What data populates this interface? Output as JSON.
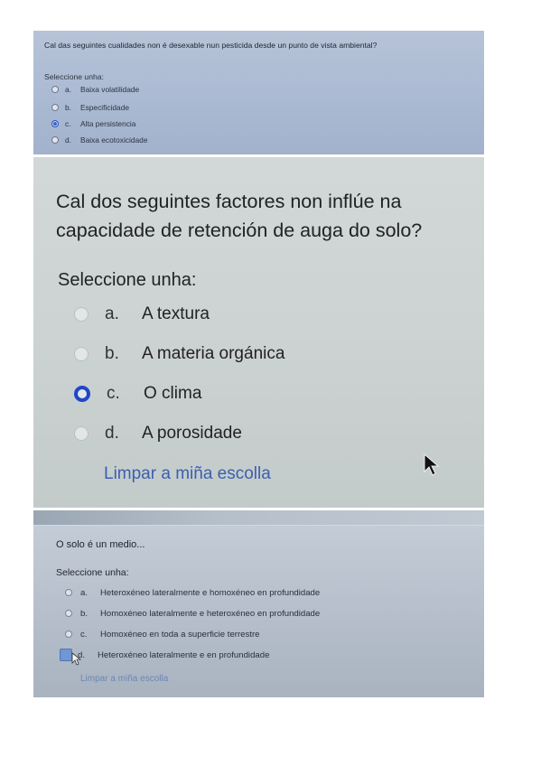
{
  "panel1": {
    "question": "Cal das seguintes cualidades non é desexable nun pesticida desde un punto de vista ambiental?",
    "prompt": "Seleccione unha:",
    "options": [
      {
        "letter": "a.",
        "text": "Baixa volatilidade",
        "selected": false
      },
      {
        "letter": "b.",
        "text": "Especificidade",
        "selected": false
      },
      {
        "letter": "c.",
        "text": "Alta persistencia",
        "selected": true
      },
      {
        "letter": "d.",
        "text": "Baixa ecotoxicidade",
        "selected": false
      }
    ]
  },
  "panel2": {
    "question": "Cal dos seguintes factores non inflúe na capacidade de retención de auga do solo?",
    "prompt": "Seleccione unha:",
    "options": [
      {
        "letter": "a.",
        "text": "A textura",
        "selected": false
      },
      {
        "letter": "b.",
        "text": "A materia orgánica",
        "selected": false
      },
      {
        "letter": "c.",
        "text": "O clima",
        "selected": true
      },
      {
        "letter": "d.",
        "text": "A porosidade",
        "selected": false
      }
    ],
    "clear_label": "Limpar a miña escolla"
  },
  "panel3": {
    "question": "O solo é un medio...",
    "prompt": "Seleccione unha:",
    "options": [
      {
        "letter": "a.",
        "text": "Heteroxéneo lateralmente e homoxéneo en profundidade",
        "selected": false
      },
      {
        "letter": "b.",
        "text": "Homoxéneo lateralmente e heteroxéneo en profundidade",
        "selected": false
      },
      {
        "letter": "c.",
        "text": "Homoxéneo en toda a superficie terrestre",
        "selected": false
      },
      {
        "letter": "d.",
        "text": "Heteroxéneo lateralmente e en profundidade",
        "selected": true
      }
    ],
    "clear_label": "Limpar a miña escolla"
  },
  "colors": {
    "selected_radio": "#1f47c8",
    "clear_link": "#3c5fae"
  }
}
